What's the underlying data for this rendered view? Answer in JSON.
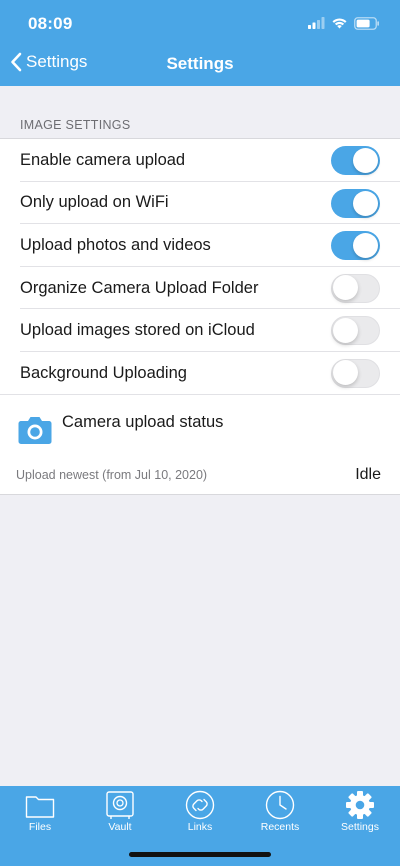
{
  "status_bar": {
    "time": "08:09"
  },
  "nav": {
    "back_label": "Settings",
    "title": "Settings"
  },
  "section": {
    "header": "IMAGE SETTINGS",
    "rows": [
      {
        "label": "Enable camera upload",
        "toggle": "on"
      },
      {
        "label": "Only upload on WiFi",
        "toggle": "on"
      },
      {
        "label": "Upload photos and videos",
        "toggle": "on"
      },
      {
        "label": "Organize Camera Upload Folder",
        "toggle": "off"
      },
      {
        "label": "Upload images stored on iCloud",
        "toggle": "off"
      },
      {
        "label": "Background Uploading",
        "toggle": "off"
      }
    ]
  },
  "upload_status": {
    "label": "Camera upload status",
    "subtitle": "Upload newest (from Jul 10, 2020)",
    "state": "Idle",
    "icon": "camera-icon"
  },
  "tabbar": {
    "tabs": [
      {
        "label": "Files",
        "icon": "folder-icon"
      },
      {
        "label": "Vault",
        "icon": "vault-icon"
      },
      {
        "label": "Links",
        "icon": "link-icon"
      },
      {
        "label": "Recents",
        "icon": "clock-icon"
      },
      {
        "label": "Settings",
        "icon": "gear-icon",
        "active": true
      }
    ]
  },
  "colors": {
    "accent": "#4aa6e6",
    "background": "#efeff4"
  }
}
